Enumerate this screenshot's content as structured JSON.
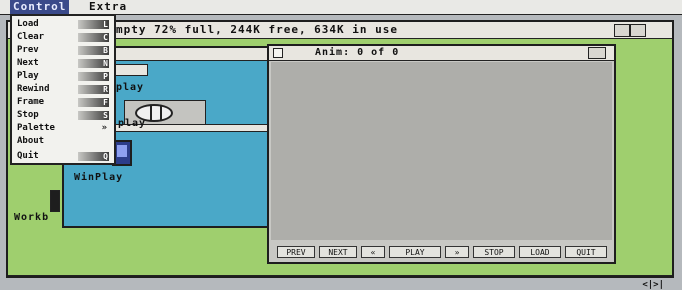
{
  "menubar": {
    "menus": [
      {
        "label": "Control"
      },
      {
        "label": "Extra"
      }
    ]
  },
  "control_menu": {
    "items": [
      {
        "label": "Load",
        "shortcut": "L"
      },
      {
        "label": "Clear",
        "shortcut": "C"
      },
      {
        "label": "Prev",
        "shortcut": "B"
      },
      {
        "label": "Next",
        "shortcut": "N"
      },
      {
        "label": "Play",
        "shortcut": "P"
      },
      {
        "label": "Rewind",
        "shortcut": "R"
      },
      {
        "label": "Frame",
        "shortcut": "F"
      },
      {
        "label": "Stop",
        "shortcut": "S"
      },
      {
        "label": "Palette",
        "shortcut": "»"
      },
      {
        "label": "About",
        "shortcut": ""
      },
      {
        "label": "Quit",
        "shortcut": "Q"
      }
    ]
  },
  "workbench": {
    "title": "mpty  72% full, 244K free, 634K in use",
    "label": "Workb"
  },
  "drawer": {
    "play_label": "play",
    "play2_label": "play",
    "winplay_label": "WinPlay"
  },
  "anim_window": {
    "title": "Anim: 0 of 0",
    "buttons": [
      "PREV",
      "NEXT",
      "«",
      "PLAY",
      "»",
      "STOP",
      "LOAD",
      "QUIT"
    ]
  },
  "footer": {
    "arrows": "<|>|"
  }
}
